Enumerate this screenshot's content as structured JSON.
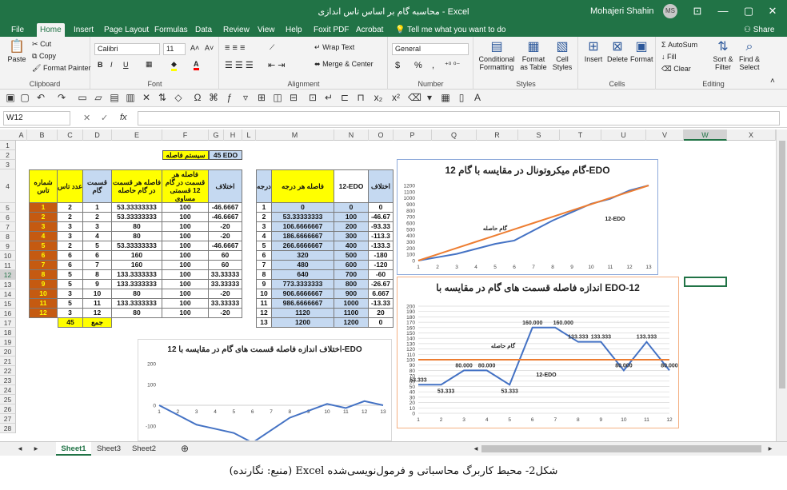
{
  "window": {
    "title": "محاسبه گام بر اساس تاس اندازی  -  Excel",
    "user": "Mohajeri Shahin",
    "avatar": "MS",
    "buttons": [
      "⊡",
      "—",
      "▢",
      "✕"
    ]
  },
  "tabs": [
    "File",
    "Home",
    "Insert",
    "Page Layout",
    "Formulas",
    "Data",
    "Review",
    "View",
    "Help",
    "Foxit PDF",
    "Acrobat"
  ],
  "active_tab": "Home",
  "tell_me": "Tell me what you want to do",
  "share": "Share",
  "ribbon": {
    "clipboard": {
      "paste": "Paste",
      "cut": "Cut",
      "copy": "Copy",
      "format_painter": "Format Painter",
      "label": "Clipboard"
    },
    "font": {
      "name": "Calibri",
      "size": "11",
      "bold": "B",
      "italic": "I",
      "underline": "U",
      "grow": "A˄",
      "shrink": "A˅",
      "label": "Font"
    },
    "alignment": {
      "wrap": "Wrap Text",
      "merge": "Merge & Center",
      "label": "Alignment"
    },
    "number": {
      "format": "General",
      "currency": "$",
      "percent": "%",
      "comma": ",",
      "label": "Number"
    },
    "styles": {
      "conditional": "Conditional Formatting",
      "table": "Format as Table",
      "cell": "Cell Styles",
      "label": "Styles"
    },
    "cells": {
      "insert": "Insert",
      "delete": "Delete",
      "format": "Format",
      "label": "Cells"
    },
    "editing": {
      "autosum": "AutoSum",
      "fill": "Fill",
      "clear": "Clear",
      "sort": "Sort & Filter",
      "find": "Find & Select",
      "label": "Editing"
    }
  },
  "formula_bar": {
    "name_box": "W12",
    "cancel": "✕",
    "enter": "✓",
    "fx": "fx",
    "formula": ""
  },
  "columns": [
    "A",
    "B",
    "C",
    "D",
    "E",
    "F",
    "G",
    "H",
    "L",
    "M",
    "N",
    "O",
    "P",
    "Q",
    "R",
    "S",
    "T",
    "U",
    "V",
    "W",
    "X"
  ],
  "selected_column": "W",
  "rows": [
    "1",
    "2",
    "3",
    "4",
    "5",
    "6",
    "7",
    "8",
    "9",
    "10",
    "11",
    "12",
    "13",
    "14",
    "15",
    "16",
    "17",
    "18",
    "19",
    "20",
    "21",
    "22",
    "23",
    "24",
    "25",
    "26",
    "27",
    "28"
  ],
  "selected_row": "12",
  "system_label": {
    "text": "سیستم فاصله",
    "value": "45 EDO"
  },
  "table1": {
    "headers": [
      "شماره تاس",
      "عدد تاس",
      "قسمت گام",
      "فاصله هر قسمت در گام حاصله",
      "فاصله هر قسمت در گام 12 قسمتی مساوی",
      "اختلاف"
    ],
    "rows": [
      [
        "1",
        "2",
        "1",
        "53.33333333",
        "100",
        "-46.6667"
      ],
      [
        "2",
        "2",
        "2",
        "53.33333333",
        "100",
        "-46.6667"
      ],
      [
        "3",
        "3",
        "3",
        "80",
        "100",
        "-20"
      ],
      [
        "4",
        "3",
        "4",
        "80",
        "100",
        "-20"
      ],
      [
        "5",
        "2",
        "5",
        "53.33333333",
        "100",
        "-46.6667"
      ],
      [
        "6",
        "6",
        "6",
        "160",
        "100",
        "60"
      ],
      [
        "7",
        "6",
        "7",
        "160",
        "100",
        "60"
      ],
      [
        "8",
        "5",
        "8",
        "133.3333333",
        "100",
        "33.33333"
      ],
      [
        "9",
        "5",
        "9",
        "133.3333333",
        "100",
        "33.33333"
      ],
      [
        "10",
        "3",
        "10",
        "80",
        "100",
        "-20"
      ],
      [
        "11",
        "5",
        "11",
        "133.3333333",
        "100",
        "33.33333"
      ],
      [
        "12",
        "3",
        "12",
        "80",
        "100",
        "-20"
      ]
    ],
    "sum_value": "45",
    "sum_label": "جمع"
  },
  "table2": {
    "headers": [
      "درجه",
      "فاصله هر درجه",
      "12-EDO",
      "اختلاف"
    ],
    "rows": [
      [
        "1",
        "0",
        "0",
        "0"
      ],
      [
        "2",
        "53.33333333",
        "100",
        "-46.67"
      ],
      [
        "3",
        "106.6666667",
        "200",
        "-93.33"
      ],
      [
        "4",
        "186.6666667",
        "300",
        "-113.3"
      ],
      [
        "5",
        "266.6666667",
        "400",
        "-133.3"
      ],
      [
        "6",
        "320",
        "500",
        "-180"
      ],
      [
        "7",
        "480",
        "600",
        "-120"
      ],
      [
        "8",
        "640",
        "700",
        "-60"
      ],
      [
        "9",
        "773.3333333",
        "800",
        "-26.67"
      ],
      [
        "10",
        "906.6666667",
        "900",
        "6.667"
      ],
      [
        "11",
        "986.6666667",
        "1000",
        "-13.33"
      ],
      [
        "12",
        "1120",
        "1100",
        "20"
      ],
      [
        "13",
        "1200",
        "1200",
        "0"
      ]
    ]
  },
  "chart_data": [
    {
      "type": "line",
      "title": "گام میکروتونال در مقایسه با گام 12-EDO",
      "x": [
        1,
        2,
        3,
        4,
        5,
        6,
        7,
        8,
        9,
        10,
        11,
        12,
        13
      ],
      "series": [
        {
          "name": "12-EDO",
          "color": "#4472c4",
          "values": [
            0,
            53.33,
            106.67,
            186.67,
            266.67,
            320,
            480,
            640,
            773.33,
            906.67,
            986.67,
            1120,
            1200
          ]
        },
        {
          "name": "گام حاصله",
          "color": "#ed7d31",
          "values": [
            0,
            100,
            200,
            300,
            400,
            500,
            600,
            700,
            800,
            900,
            1000,
            1100,
            1200
          ]
        }
      ],
      "ylim": [
        0,
        1200
      ],
      "yticks": [
        0,
        100,
        200,
        300,
        400,
        500,
        600,
        700,
        800,
        900,
        1000,
        1100,
        1200
      ],
      "grid": false
    },
    {
      "type": "line",
      "title": "اندازه فاصله قسمت های گام در مقایسه با EDO-12",
      "x": [
        1,
        2,
        3,
        4,
        5,
        6,
        7,
        8,
        9,
        10,
        11,
        12
      ],
      "series": [
        {
          "name": "گام حاصله",
          "color": "#4472c4",
          "values": [
            53.333,
            53.333,
            80,
            80,
            53.333,
            160,
            160,
            133.333,
            133.333,
            80,
            133.333,
            80
          ]
        },
        {
          "name": "12-EDO",
          "color": "#ed7d31",
          "values": [
            100,
            100,
            100,
            100,
            100,
            100,
            100,
            100,
            100,
            100,
            100,
            100
          ]
        }
      ],
      "data_labels": [
        "53.333",
        "53.333",
        "80.000",
        "80.000",
        "53.333",
        "160.000",
        "160.000",
        "133.333",
        "133.333",
        "80.000",
        "133.333",
        "80.000"
      ],
      "ylim": [
        0,
        200
      ],
      "yticks": [
        0,
        10,
        20,
        30,
        40,
        50,
        60,
        70,
        80,
        90,
        100,
        110,
        120,
        130,
        140,
        150,
        160,
        170,
        180,
        190,
        200
      ],
      "grid": true
    },
    {
      "type": "line",
      "title": "اختلاف اندازه فاصله قسمت های گام در مقایسه با 12-EDO",
      "x": [
        1,
        2,
        3,
        4,
        5,
        6,
        7,
        8,
        9,
        10,
        11,
        12,
        13
      ],
      "series": [
        {
          "color": "#4472c4",
          "values": [
            0,
            -46.67,
            -93.33,
            -113.3,
            -133.3,
            -180,
            -120,
            -60,
            -26.67,
            6.667,
            -13.33,
            20,
            0
          ]
        }
      ],
      "ylim": [
        -200,
        200
      ],
      "yticks": [
        200,
        100,
        0,
        -100
      ],
      "grid": false
    }
  ],
  "sheets": [
    "Sheet1",
    "Sheet3",
    "Sheet2"
  ],
  "active_sheet": "Sheet1",
  "caption": "شکل2- محیط کاربرگ محاسباتی و فرمول‌نویسی‌شده Excel (منبع: نگارنده)"
}
